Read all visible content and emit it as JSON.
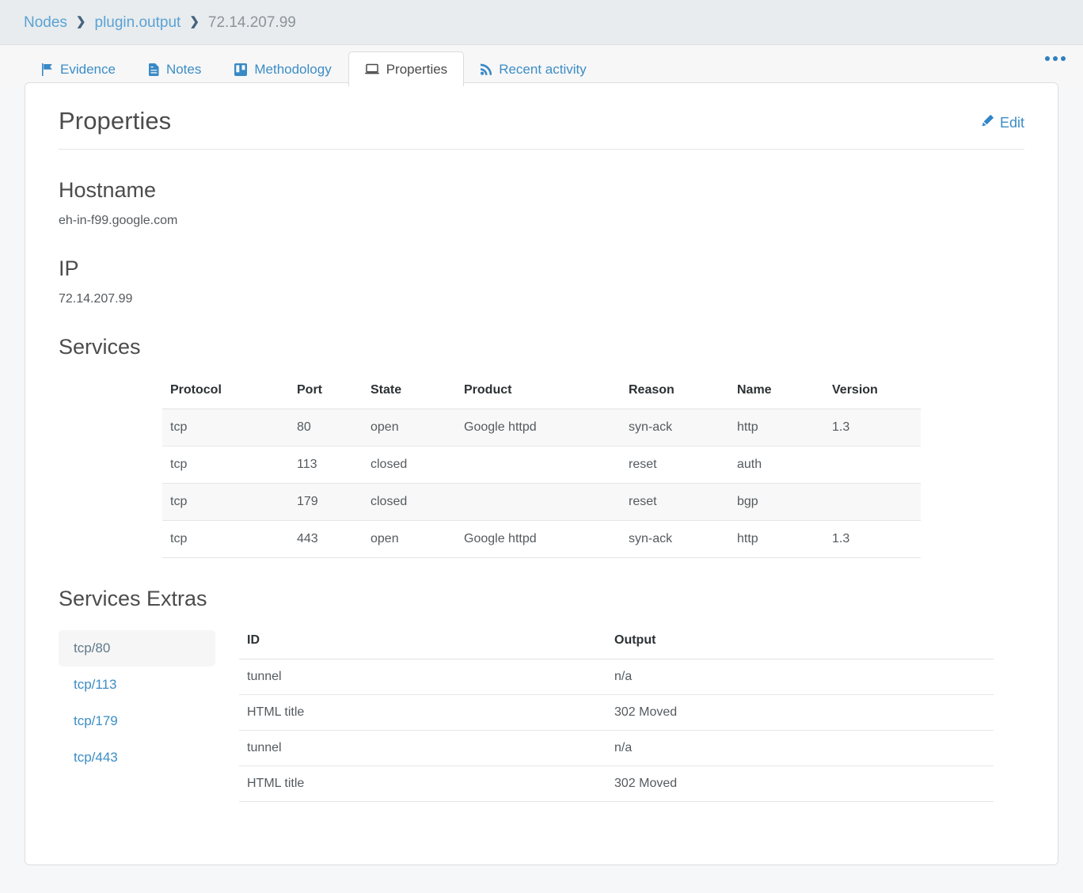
{
  "breadcrumb": {
    "separator": "❯",
    "items": [
      {
        "label": "Nodes",
        "current": false
      },
      {
        "label": "plugin.output",
        "current": false
      },
      {
        "label": "72.14.207.99",
        "current": true
      }
    ]
  },
  "tabs": [
    {
      "label": "Evidence",
      "icon": "flag-icon",
      "active": false
    },
    {
      "label": "Notes",
      "icon": "file-text-icon",
      "active": false
    },
    {
      "label": "Methodology",
      "icon": "columns-icon",
      "active": false
    },
    {
      "label": "Properties",
      "icon": "laptop-icon",
      "active": true
    },
    {
      "label": "Recent activity",
      "icon": "rss-icon",
      "active": false
    }
  ],
  "overflow_menu": {
    "name": "more-options",
    "label": "•••"
  },
  "page": {
    "title": "Properties",
    "edit_label": "Edit"
  },
  "sections": {
    "hostname": {
      "title": "Hostname",
      "value": "eh-in-f99.google.com"
    },
    "ip": {
      "title": "IP",
      "value": "72.14.207.99"
    },
    "services": {
      "title": "Services",
      "columns": [
        "Protocol",
        "Port",
        "State",
        "Product",
        "Reason",
        "Name",
        "Version"
      ],
      "rows": [
        {
          "protocol": "tcp",
          "port": "80",
          "state": "open",
          "product": "Google httpd",
          "reason": "syn-ack",
          "name": "http",
          "version": "1.3"
        },
        {
          "protocol": "tcp",
          "port": "113",
          "state": "closed",
          "product": "",
          "reason": "reset",
          "name": "auth",
          "version": ""
        },
        {
          "protocol": "tcp",
          "port": "179",
          "state": "closed",
          "product": "",
          "reason": "reset",
          "name": "bgp",
          "version": ""
        },
        {
          "protocol": "tcp",
          "port": "443",
          "state": "open",
          "product": "Google httpd",
          "reason": "syn-ack",
          "name": "http",
          "version": "1.3"
        }
      ]
    },
    "services_extras": {
      "title": "Services Extras",
      "nav": [
        {
          "label": "tcp/80",
          "active": true
        },
        {
          "label": "tcp/113",
          "active": false
        },
        {
          "label": "tcp/179",
          "active": false
        },
        {
          "label": "tcp/443",
          "active": false
        }
      ],
      "columns": [
        "ID",
        "Output"
      ],
      "rows": [
        {
          "id": "tunnel",
          "output": "n/a"
        },
        {
          "id": "HTML title",
          "output": "302 Moved"
        },
        {
          "id": "tunnel",
          "output": "n/a"
        },
        {
          "id": "HTML title",
          "output": "302 Moved"
        }
      ]
    }
  },
  "colors": {
    "link": "#3c8dc5",
    "breadcrumb_bar": "#e8ecee",
    "page_bg": "#f6f7f8",
    "card_bg": "#ffffff",
    "muted_text": "#8d9499"
  }
}
